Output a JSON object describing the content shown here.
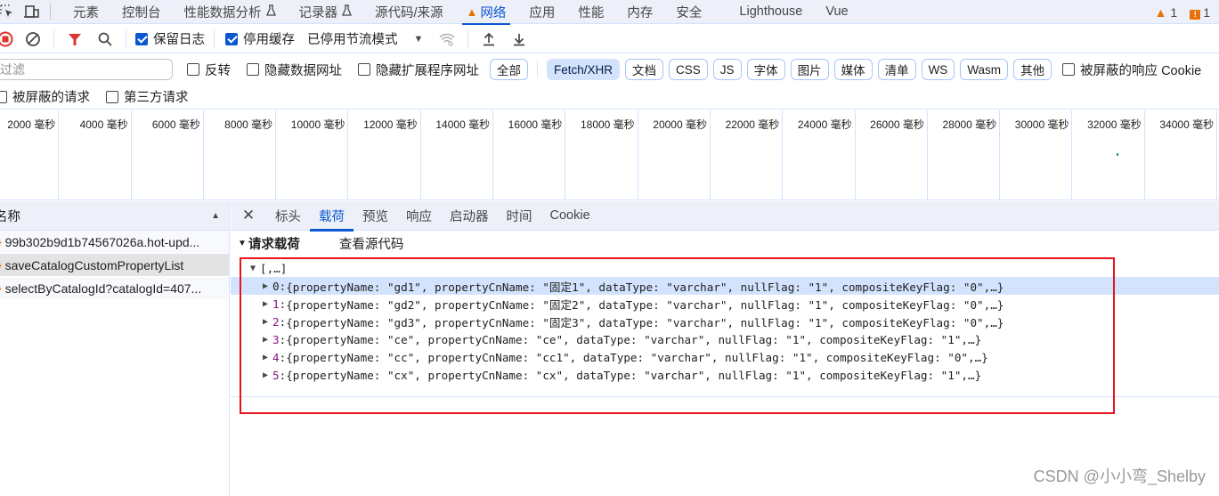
{
  "top_tabs": [
    {
      "label": "元素",
      "active": false
    },
    {
      "label": "控制台",
      "active": false
    },
    {
      "label": "性能数据分析",
      "active": false,
      "experimental": true
    },
    {
      "label": "记录器",
      "active": false,
      "experimental": true
    },
    {
      "label": "源代码/来源",
      "active": false
    },
    {
      "label": "网络",
      "active": true,
      "warning": true
    },
    {
      "label": "应用",
      "active": false
    },
    {
      "label": "性能",
      "active": false
    },
    {
      "label": "内存",
      "active": false
    },
    {
      "label": "安全",
      "active": false
    },
    {
      "label": "Lighthouse",
      "active": false
    },
    {
      "label": "Vue",
      "active": false
    }
  ],
  "status": {
    "warnings": "1",
    "errors": "1"
  },
  "toolbar": {
    "preserve_log": {
      "label": "保留日志",
      "checked": true
    },
    "disable_cache": {
      "label": "停用缓存",
      "checked": true
    },
    "throttling": "已停用节流模式"
  },
  "filter": {
    "placeholder": "过滤",
    "invert": {
      "label": "反转",
      "checked": false
    },
    "hide_data_urls": {
      "label": "隐藏数据网址",
      "checked": false
    },
    "hide_ext_urls": {
      "label": "隐藏扩展程序网址",
      "checked": false
    },
    "types": [
      {
        "label": "全部",
        "active": false
      },
      {
        "label": "Fetch/XHR",
        "active": true
      },
      {
        "label": "文档",
        "active": false
      },
      {
        "label": "CSS",
        "active": false
      },
      {
        "label": "JS",
        "active": false
      },
      {
        "label": "字体",
        "active": false
      },
      {
        "label": "图片",
        "active": false
      },
      {
        "label": "媒体",
        "active": false
      },
      {
        "label": "清单",
        "active": false
      },
      {
        "label": "WS",
        "active": false
      },
      {
        "label": "Wasm",
        "active": false
      },
      {
        "label": "其他",
        "active": false
      }
    ],
    "blocked_cookies": {
      "label": "被屏蔽的响应 Cookie",
      "checked": false
    },
    "blocked_requests": {
      "label": "被屏蔽的请求",
      "checked": false
    },
    "third_party": {
      "label": "第三方请求",
      "checked": false
    }
  },
  "overview": {
    "ticks": [
      "2000 毫秒",
      "4000 毫秒",
      "6000 毫秒",
      "8000 毫秒",
      "10000 毫秒",
      "12000 毫秒",
      "14000 毫秒",
      "16000 毫秒",
      "18000 毫秒",
      "20000 毫秒",
      "22000 毫秒",
      "24000 毫秒",
      "26000 毫秒",
      "28000 毫秒",
      "30000 毫秒",
      "32000 毫秒",
      "34000 毫秒"
    ]
  },
  "requests": {
    "header": "名称",
    "items": [
      {
        "name": "99b302b9d1b74567026a.hot-upd...",
        "selected": false
      },
      {
        "name": "saveCatalogCustomPropertyList",
        "selected": true
      },
      {
        "name": "selectByCatalogId?catalogId=407...",
        "selected": false
      }
    ]
  },
  "detail": {
    "tabs": [
      {
        "label": "标头",
        "active": false
      },
      {
        "label": "载荷",
        "active": true
      },
      {
        "label": "预览",
        "active": false
      },
      {
        "label": "响应",
        "active": false
      },
      {
        "label": "启动器",
        "active": false
      },
      {
        "label": "时间",
        "active": false
      },
      {
        "label": "Cookie",
        "active": false
      }
    ],
    "section_title": "请求载荷",
    "view_source": "查看源代码",
    "root": "[,…]",
    "rows": [
      {
        "index": "0",
        "text": "{propertyName: \"gd1\", propertyCnName: \"固定1\", dataType: \"varchar\", nullFlag: \"1\", compositeKeyFlag: \"0\",…}"
      },
      {
        "index": "1",
        "text": "{propertyName: \"gd2\", propertyCnName: \"固定2\", dataType: \"varchar\", nullFlag: \"1\", compositeKeyFlag: \"0\",…}"
      },
      {
        "index": "2",
        "text": "{propertyName: \"gd3\", propertyCnName: \"固定3\", dataType: \"varchar\", nullFlag: \"1\", compositeKeyFlag: \"0\",…}"
      },
      {
        "index": "3",
        "text": "{propertyName: \"ce\", propertyCnName: \"ce\", dataType: \"varchar\", nullFlag: \"1\", compositeKeyFlag: \"1\",…}"
      },
      {
        "index": "4",
        "text": "{propertyName: \"cc\", propertyCnName: \"cc1\", dataType: \"varchar\", nullFlag: \"1\", compositeKeyFlag: \"0\",…}"
      },
      {
        "index": "5",
        "text": "{propertyName: \"cx\", propertyCnName: \"cx\", dataType: \"varchar\", nullFlag: \"1\", compositeKeyFlag: \"1\",…}"
      }
    ]
  },
  "watermark": "CSDN @小小弯_Shelby",
  "colors": {
    "accent": "#0b57d0",
    "warning": "#e8710a",
    "annotation": "#e8141b"
  }
}
